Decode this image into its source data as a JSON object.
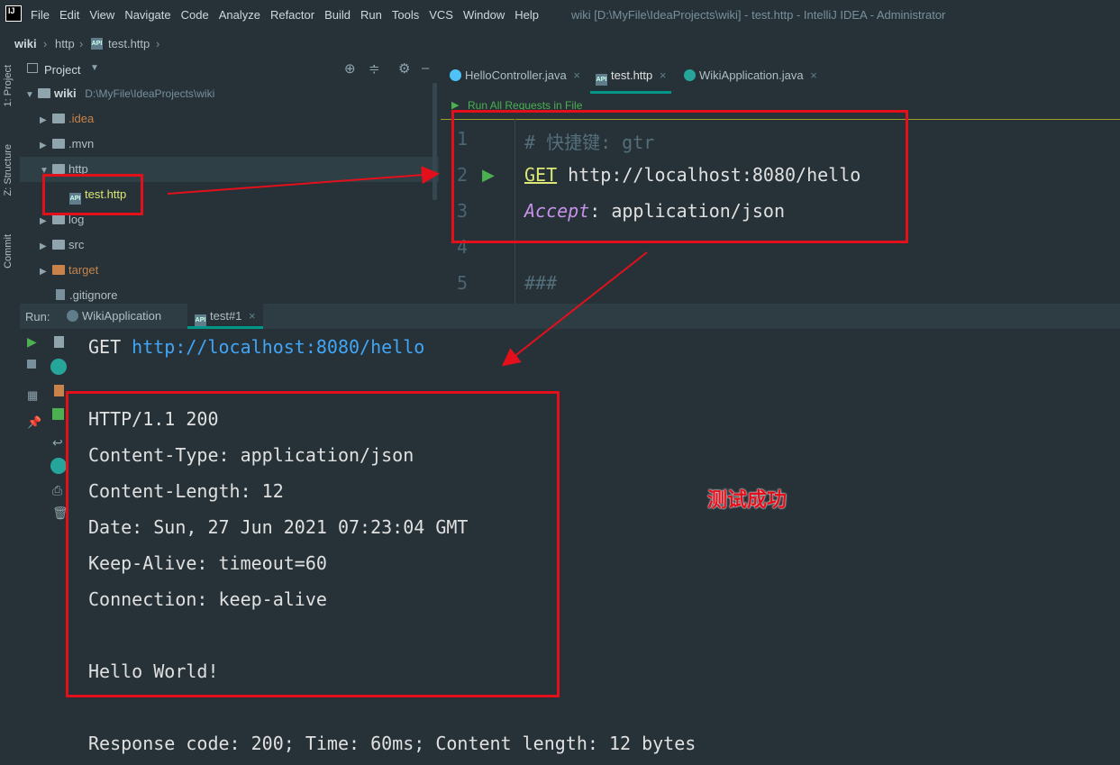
{
  "menubar": {
    "items": [
      "File",
      "Edit",
      "View",
      "Navigate",
      "Code",
      "Analyze",
      "Refactor",
      "Build",
      "Run",
      "Tools",
      "VCS",
      "Window",
      "Help"
    ],
    "window_title": "wiki [D:\\MyFile\\IdeaProjects\\wiki] - test.http - IntelliJ IDEA - Administrator"
  },
  "breadcrumb": [
    "wiki",
    "http",
    "test.http"
  ],
  "left_strip": {
    "project": "1: Project",
    "structure": "Z: Structure",
    "commit": "Commit"
  },
  "project_panel": {
    "title": "Project",
    "root": {
      "name": "wiki",
      "path": "D:\\MyFile\\IdeaProjects\\wiki"
    },
    "items": [
      ".idea",
      ".mvn",
      "http",
      "test.http",
      "log",
      "src",
      "target",
      ".gitignore"
    ]
  },
  "editor": {
    "tabs": [
      "HelloController.java",
      "test.http",
      "WikiApplication.java"
    ],
    "run_all": "Run All Requests in File",
    "lines": [
      {
        "num": "1",
        "text": "# 快捷键: gtr"
      },
      {
        "num": "2",
        "method": "GET",
        "url": " http://localhost:8080/hello"
      },
      {
        "num": "3",
        "header_name": "Accept",
        "header_value": ": application/json"
      },
      {
        "num": "4",
        "text": ""
      },
      {
        "num": "5",
        "text": "###"
      }
    ]
  },
  "run": {
    "label": "Run:",
    "tabs": [
      "WikiApplication",
      "test#1"
    ],
    "request_method": "GET",
    "request_url": "http://localhost:8080/hello",
    "response_lines": [
      "HTTP/1.1 200",
      "Content-Type: application/json",
      "Content-Length: 12",
      "Date: Sun, 27 Jun 2021 07:23:04 GMT",
      "Keep-Alive: timeout=60",
      "Connection: keep-alive"
    ],
    "body": "Hello World!",
    "summary": "Response code: 200; Time: 60ms; Content length: 12 bytes"
  },
  "annotation": {
    "text": "测试成功"
  },
  "colors": {
    "accent": "#009688",
    "highlight_box": "#e3101c",
    "url_blue": "#42a5f5",
    "header_purple": "#c792ea"
  }
}
